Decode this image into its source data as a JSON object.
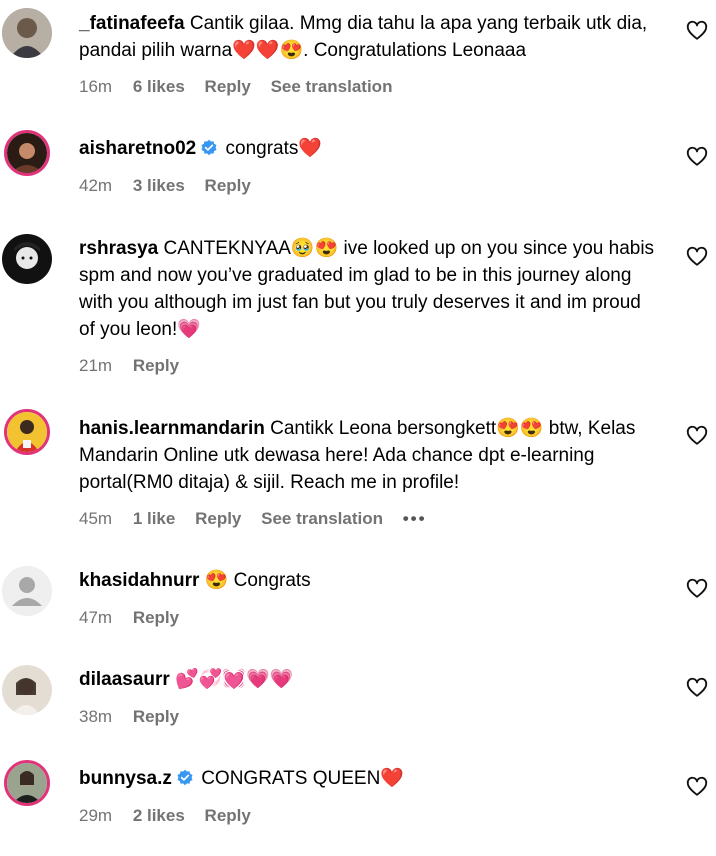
{
  "comments": [
    {
      "username": "_fatinafeefa",
      "text": "Cantik gilaa. Mmg dia tahu la apa yang terbaik utk dia, pandai pilih warna❤️❤️😍. Congratulations Leonaaa",
      "time": "16m",
      "likes": "6 likes",
      "reply": "Reply",
      "translation": "See translation",
      "verified": false
    },
    {
      "username": "aisharetno02",
      "text": "congrats❤️",
      "time": "42m",
      "likes": "3 likes",
      "reply": "Reply",
      "verified": true
    },
    {
      "username": "rshrasya",
      "text": "CANTEKNYAA🥹😍 ive looked up on you since you habis spm and now you’ve graduated im glad to be in this journey along with you although im just fan but you truly deserves it and im proud of you leon!💗",
      "time": "21m",
      "reply": "Reply",
      "verified": false
    },
    {
      "username": "hanis.learnmandarin",
      "text": "Cantikk Leona bersongkett😍😍 btw, Kelas Mandarin Online utk dewasa here! Ada chance dpt e-learning portal(RM0 ditaja) & sijil. Reach me in profile!",
      "time": "45m",
      "likes": "1 like",
      "reply": "Reply",
      "translation": "See translation",
      "more": "•••",
      "verified": false
    },
    {
      "username": "khasidahnurr",
      "text": "😍 Congrats",
      "time": "47m",
      "reply": "Reply",
      "verified": false
    },
    {
      "username": "dilaasaurr",
      "text": "💕💞💓💗💗",
      "time": "38m",
      "reply": "Reply",
      "verified": false
    },
    {
      "username": "bunnysa.z",
      "text": "CONGRATS QUEEN❤️",
      "time": "29m",
      "likes": "2 likes",
      "reply": "Reply",
      "verified": true
    }
  ],
  "colors": {
    "meta": "#737373",
    "story_ring": "#e0337a",
    "verified": "#3897f0"
  },
  "icons": {
    "like": "heart-outline-icon",
    "verified": "verified-badge-icon",
    "default_avatar": "default-avatar-icon"
  }
}
